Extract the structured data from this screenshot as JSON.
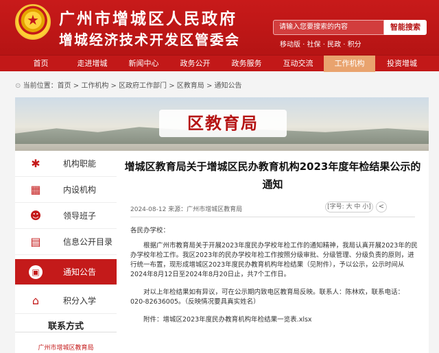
{
  "header": {
    "title": "广州市增城区人民政府",
    "subtitle": "增城经济技术开发区管委会",
    "search_placeholder": "请输入您要搜索的内容",
    "search_button": "智能搜索",
    "quick_links": "移动版 · 社保 · 民政 · 积分"
  },
  "nav": [
    "首页",
    "走进增城",
    "新闻中心",
    "政务公开",
    "政务服务",
    "互动交流",
    "工作机构",
    "投资增城"
  ],
  "breadcrumb": "当前位置：首页 > 工作机构 > 区政府工作部门 > 区教育局 > 通知公告",
  "banner_title": "区教育局",
  "sidebar": {
    "items": [
      "机构职能",
      "内设机构",
      "领导班子",
      "信息公开目录",
      "通知公告",
      "积分入学"
    ],
    "contact_title": "联系方式",
    "contact_org": "广州市增城区教育局"
  },
  "article": {
    "title_line1": "增城区教育局关于增城区民办教育机构2023年度年检结果公示的",
    "title_line2": "通知",
    "meta": "2024-08-12 来源：广州市增城区教育局",
    "font_size": "[字号: 大 中 小]",
    "salutation": "各民办学校：",
    "para1": "根据广州市教育局关于开展2023年度民办学校年检工作的通知精神，我局认真开展2023年的民办学校年检工作。我区2023年的民办学校年检工作按照分级审批、分级管理、分级负责的原则，进行统一布置，现形成增城区2023年度民办教育机构年检结果（见附件），予以公示，公示时间从2024年8月12日至2024年8月20日止，共7个工作日。",
    "para2": "对以上年检结果如有异议，可在公示期内致电区教育局反映。联系人：陈林欢，联系电话：020-82636005。（反映情况要具真实姓名）",
    "attachment": "附件：增城区2023年度民办教育机构年检结果一览表.xlsx"
  },
  "colors": {
    "brand_red": "#c41a1a",
    "nav_active": "#e9a36e"
  }
}
